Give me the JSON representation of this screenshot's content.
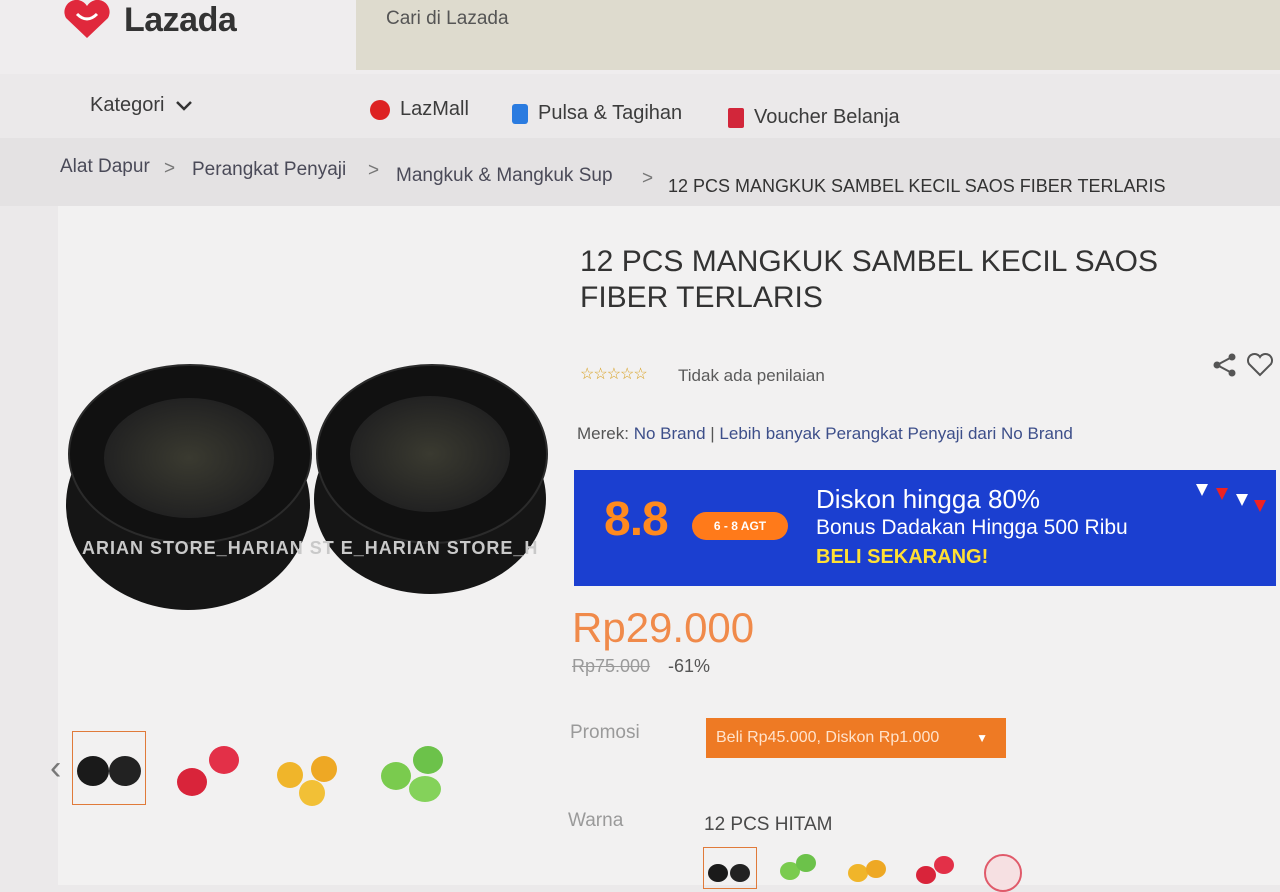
{
  "header": {
    "logo_text": "Lazada",
    "search_placeholder": "Cari di Lazada"
  },
  "nav": {
    "category_label": "Kategori",
    "items": [
      {
        "label": "LazMall",
        "icon": "lazmall-icon"
      },
      {
        "label": "Pulsa & Tagihan",
        "icon": "phone-icon"
      },
      {
        "label": "Voucher Belanja",
        "icon": "voucher-icon"
      }
    ]
  },
  "breadcrumb": [
    "Alat Dapur",
    "Perangkat Penyaji",
    "Mangkuk & Mangkuk Sup",
    "12 PCS MANGKUK SAMBEL KECIL SAOS FIBER TERLARIS"
  ],
  "product": {
    "title_line1": "12 PCS MANGKUK SAMBEL KECIL SAOS",
    "title_line2": "FIBER TERLARIS",
    "stars": "☆☆☆☆☆",
    "rating_text": "Tidak ada penilaian",
    "brand_label": "Merek:",
    "brand_name": "No Brand",
    "brand_more": "Lebih banyak Perangkat Penyaji dari No Brand",
    "watermark": "ARIAN STORE_HARIAN ST   E_HARIAN STORE_H",
    "price": "Rp29.000",
    "old_price": "Rp75.000",
    "discount": "-61%",
    "promo_label": "Promosi",
    "promo_text": "Beli Rp45.000, Diskon Rp1.000",
    "color_label": "Warna",
    "color_value": "12 PCS HITAM"
  },
  "banner": {
    "event": "8.8",
    "date": "6 - 8 AGT",
    "line1": "Diskon hingga 80%",
    "line2": "Bonus Dadakan Hingga 500 Ribu",
    "cta": "BELI SEKARANG!"
  },
  "colors": {
    "accent": "#f08a4a",
    "banner_bg": "#1b3fd0",
    "promo_bg": "#ee7a24",
    "thumbs": [
      "#1a1a1a",
      "#d9243a",
      "#f0b52a",
      "#6cc24a"
    ]
  }
}
